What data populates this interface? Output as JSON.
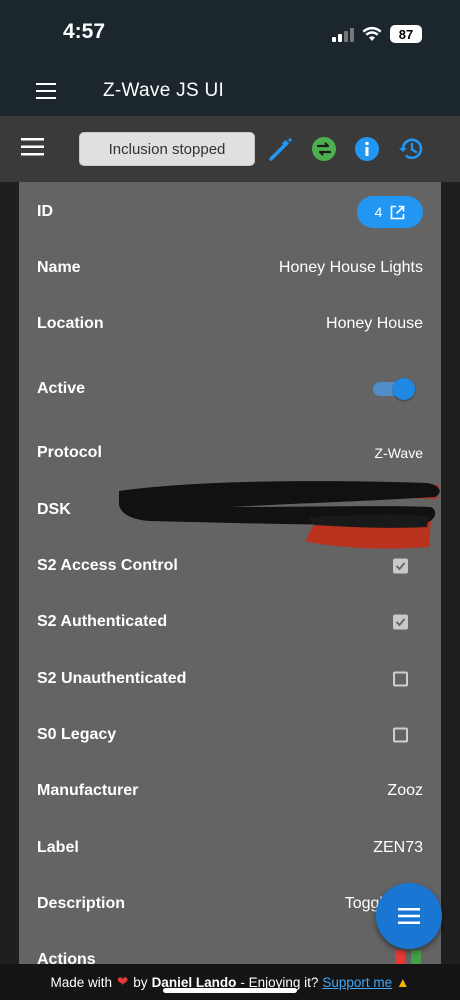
{
  "status_bar": {
    "time": "4:57",
    "battery": "87"
  },
  "app": {
    "title": "Z-Wave JS UI"
  },
  "toolbar": {
    "inclusion_label": "Inclusion stopped"
  },
  "node": {
    "id_label": "ID",
    "id_value": "4",
    "name_label": "Name",
    "name_value": "Honey House Lights",
    "location_label": "Location",
    "location_value": "Honey House",
    "active_label": "Active",
    "active_value": true,
    "protocol_label": "Protocol",
    "protocol_value": "Z-Wave",
    "dsk_label": "DSK",
    "s2_access_label": "S2 Access Control",
    "s2_access_checked": true,
    "s2_auth_label": "S2 Authenticated",
    "s2_auth_checked": true,
    "s2_unauth_label": "S2 Unauthenticated",
    "s2_unauth_checked": false,
    "s0_label": "S0 Legacy",
    "s0_checked": false,
    "manufacturer_label": "Manufacturer",
    "manufacturer_value": "Zooz",
    "label_label": "Label",
    "label_value": "ZEN73",
    "description_label": "Description",
    "description_value": "Toggle S",
    "actions_label": "Actions"
  },
  "footer": {
    "made_with": "Made with",
    "by": "by",
    "author": "Daniel Lando",
    "enjoying": "- Enjoying it?",
    "support": "Support me"
  },
  "colors": {
    "accent": "#2196f3",
    "header_bg": "#1b272d",
    "card_bg": "#646464",
    "swap_green": "#4caf50"
  },
  "icons": {
    "menu": "menu-icon",
    "wand": "magic-wand-icon",
    "swap": "swap-icon",
    "info": "info-icon",
    "history": "history-icon",
    "open_external": "open-in-new-icon",
    "fab": "menu-icon"
  }
}
